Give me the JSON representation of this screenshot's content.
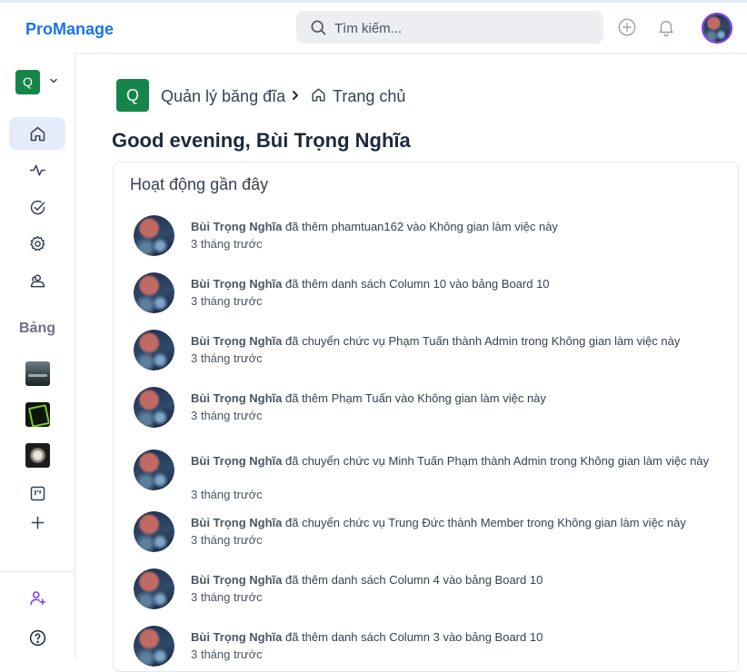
{
  "header": {
    "brand": "ProManage",
    "search_placeholder": "Tìm kiếm..."
  },
  "sidebar": {
    "workspace_initial": "Q",
    "boards_heading": "Bảng"
  },
  "breadcrumb": {
    "workspace_initial": "Q",
    "workspace_name": "Quản lý băng đĩa",
    "page": "Trang chủ"
  },
  "main": {
    "greeting": "Good evening, Bùi Trọng Nghĩa"
  },
  "recent_activity": {
    "title": "Hoạt động gần đây",
    "items": [
      {
        "actor": "Bùi Trọng Nghĩa",
        "action": " đã thêm phamtuan162 vào Không gian làm việc này",
        "time": "3 tháng trước"
      },
      {
        "actor": "Bùi Trọng Nghĩa",
        "action": " đã thêm danh sách Column 10 vào bảng Board 10",
        "time": "3 tháng trước"
      },
      {
        "actor": "Bùi Trọng Nghĩa",
        "action": " đã chuyển chức vụ Phạm Tuấn thành Admin trong Không gian làm việc này",
        "time": "3 tháng trước"
      },
      {
        "actor": "Bùi Trọng Nghĩa",
        "action": " đã thêm Phạm Tuấn vào Không gian làm việc này",
        "time": "3 tháng trước"
      },
      {
        "actor": "Bùi Trọng Nghĩa",
        "action": " đã chuyển chức vụ Minh Tuấn Phạm thành Admin trong Không gian làm việc này",
        "time": "3 tháng trước"
      },
      {
        "actor": "Bùi Trọng Nghĩa",
        "action": " đã chuyển chức vụ Trung Đức thành Member trong Không gian làm việc này",
        "time": "3 tháng trước"
      },
      {
        "actor": "Bùi Trọng Nghĩa",
        "action": " đã thêm danh sách Column 4 vào bảng Board 10",
        "time": "3 tháng trước"
      },
      {
        "actor": "Bùi Trọng Nghĩa",
        "action": " đã thêm danh sách Column 3 vào bảng Board 10",
        "time": "3 tháng trước"
      }
    ]
  },
  "colors": {
    "brand": "#1a73e8",
    "workspace_badge": "#16854a",
    "active_nav_bg": "#e6ebfb",
    "avatar_ring": "#7c3aed"
  }
}
